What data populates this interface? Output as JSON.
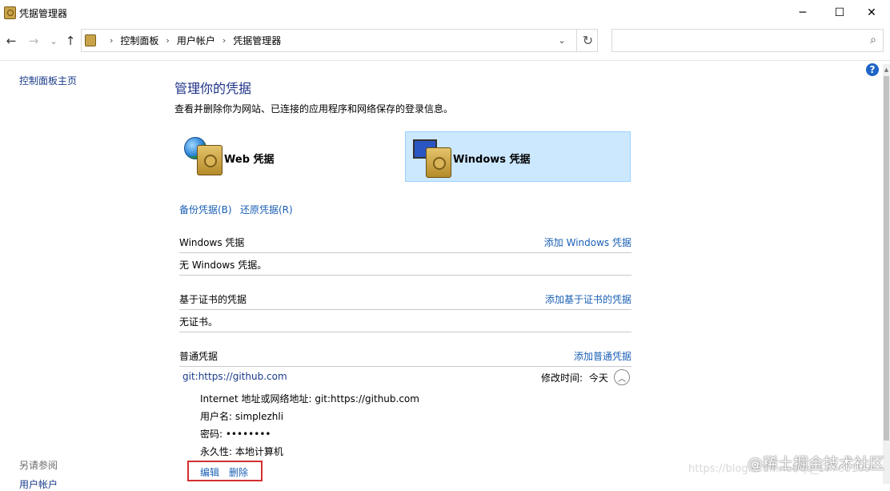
{
  "window": {
    "title": "凭据管理器",
    "controls": {
      "minimize": "─",
      "maximize": "☐",
      "close": "✕"
    }
  },
  "nav": {
    "back": "←",
    "forward": "→",
    "recent": "⌄",
    "up": "↑",
    "breadcrumbs": [
      "控制面板",
      "用户帐户",
      "凭据管理器"
    ],
    "separator": "›",
    "dropdown": "⌄",
    "refresh": "↻",
    "search_placeholder": "",
    "search_icon": "⌕"
  },
  "left_pane": {
    "home_link": "控制面板主页",
    "see_also": "另请参阅",
    "user_accounts": "用户帐户"
  },
  "help": "?",
  "main": {
    "title": "管理你的凭据",
    "description": "查看并删除你为网站、已连接的应用程序和网络保存的登录信息。",
    "tiles": [
      {
        "label": "Web 凭据",
        "icon": "globe-vault-icon",
        "selected": false
      },
      {
        "label": "Windows 凭据",
        "icon": "monitor-vault-icon",
        "selected": true
      }
    ],
    "backup_link": "备份凭据(B)",
    "restore_link": "还原凭据(R)",
    "sections": {
      "windows": {
        "title": "Windows 凭据",
        "action": "添加 Windows 凭据",
        "empty": "无 Windows 凭据。"
      },
      "certificate": {
        "title": "基于证书的凭据",
        "action": "添加基于证书的凭据",
        "empty": "无证书。"
      },
      "generic": {
        "title": "普通凭据",
        "action": "添加普通凭据",
        "entry": {
          "target": "git:https://github.com",
          "modified_label": "修改时间:",
          "modified_value": "今天",
          "collapse": "︿",
          "address_line": "Internet 地址或网络地址: git:https://github.com",
          "username_line": "用户名: simplezhli",
          "password_line": "密码: ••••••••",
          "persistence_line": "永久性: 本地计算机",
          "edit": "编辑",
          "delete": "删除"
        }
      }
    }
  },
  "watermark": {
    "url": "https://blog.csdn.net/qq_17766199",
    "brand": "@稀土掘金技术社区"
  },
  "colors": {
    "selected_tile": "#cce8ff",
    "link": "#1a5fb4",
    "highlight_box": "#d32f2f",
    "help": "#1d64c8"
  }
}
